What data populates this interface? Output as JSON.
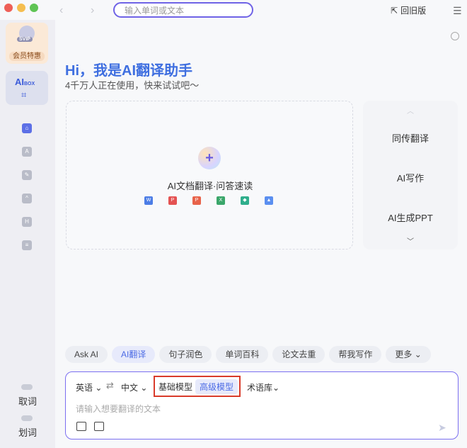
{
  "window": {
    "search_placeholder": "输入单词或文本",
    "old_version_label": "回旧版"
  },
  "sidebar": {
    "vip_badge": "SVIP",
    "vip_text": "会员特惠",
    "aibox_label": "AI",
    "aibox_sub": "BOX",
    "bottom_items": [
      {
        "label": "取词"
      },
      {
        "label": "划词"
      }
    ]
  },
  "main": {
    "greeting": "Hi，我是AI翻译助手",
    "subtitle": "4千万人正在使用，快来试试吧～",
    "upload": {
      "title": "AI文档翻译·问答速读",
      "formats": [
        "word-icon",
        "pdf-icon",
        "ppt-icon",
        "excel-icon",
        "webpage-icon",
        "image-icon"
      ]
    },
    "side_panel": {
      "items": [
        "同传翻译",
        "AI写作",
        "AI生成PPT"
      ]
    },
    "chips": [
      "Ask AI",
      "AI翻译",
      "句子润色",
      "单词百科",
      "论文去重",
      "帮我写作",
      "更多"
    ],
    "active_chip": 1,
    "input": {
      "source_lang": "英语",
      "target_lang": "中文",
      "models": [
        "基础模型",
        "高级模型"
      ],
      "active_model": 1,
      "terms": "术语库",
      "placeholder": "请输入想要翻译的文本"
    }
  },
  "colors": {
    "accent": "#5c6fe6",
    "highlight_box": "#d93b2b",
    "greeting": "#3f6fe0"
  }
}
